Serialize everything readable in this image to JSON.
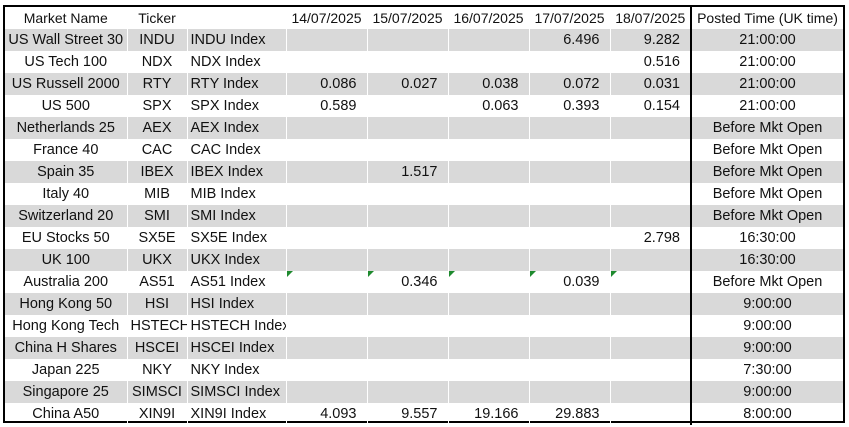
{
  "headers": [
    "Market Name",
    "Ticker",
    "",
    "14/07/2025",
    "15/07/2025",
    "16/07/2025",
    "17/07/2025",
    "18/07/2025",
    "Posted Time (UK time)"
  ],
  "rows": [
    {
      "market": "US Wall Street 30",
      "ticker": "INDU",
      "index": "INDU  Index",
      "vals": [
        "",
        "",
        "",
        "6.496",
        "9.282"
      ],
      "posted": "21:00:00",
      "flags": [
        false,
        false,
        false,
        false,
        false
      ]
    },
    {
      "market": "US Tech 100",
      "ticker": "NDX",
      "index": "NDX Index",
      "vals": [
        "",
        "",
        "",
        "",
        "0.516"
      ],
      "posted": "21:00:00",
      "flags": [
        false,
        false,
        false,
        false,
        false
      ]
    },
    {
      "market": "US Russell 2000",
      "ticker": "RTY",
      "index": "RTY Index",
      "vals": [
        "0.086",
        "0.027",
        "0.038",
        "0.072",
        "0.031"
      ],
      "posted": "21:00:00",
      "flags": [
        false,
        false,
        false,
        false,
        false
      ]
    },
    {
      "market": "US 500",
      "ticker": "SPX",
      "index": "SPX Index",
      "vals": [
        "0.589",
        "",
        "0.063",
        "0.393",
        "0.154"
      ],
      "posted": "21:00:00",
      "flags": [
        false,
        false,
        false,
        false,
        false
      ]
    },
    {
      "market": "Netherlands 25",
      "ticker": "AEX",
      "index": "AEX Index",
      "vals": [
        "",
        "",
        "",
        "",
        ""
      ],
      "posted": "Before Mkt Open",
      "flags": [
        false,
        false,
        false,
        false,
        false
      ]
    },
    {
      "market": "France 40",
      "ticker": "CAC",
      "index": "CAC Index",
      "vals": [
        "",
        "",
        "",
        "",
        ""
      ],
      "posted": "Before Mkt Open",
      "flags": [
        false,
        false,
        false,
        false,
        false
      ]
    },
    {
      "market": "Spain 35",
      "ticker": "IBEX",
      "index": "IBEX Index",
      "vals": [
        "",
        "1.517",
        "",
        "",
        ""
      ],
      "posted": "Before Mkt Open",
      "flags": [
        false,
        false,
        false,
        false,
        false
      ]
    },
    {
      "market": "Italy 40",
      "ticker": "MIB",
      "index": "MIB Index",
      "vals": [
        "",
        "",
        "",
        "",
        ""
      ],
      "posted": "Before Mkt Open",
      "flags": [
        false,
        false,
        false,
        false,
        false
      ]
    },
    {
      "market": "Switzerland 20",
      "ticker": "SMI",
      "index": "SMI Index",
      "vals": [
        "",
        "",
        "",
        "",
        ""
      ],
      "posted": "Before Mkt Open",
      "flags": [
        false,
        false,
        false,
        false,
        false
      ]
    },
    {
      "market": "EU Stocks 50",
      "ticker": "SX5E",
      "index": "SX5E Index",
      "vals": [
        "",
        "",
        "",
        "",
        "2.798"
      ],
      "posted": "16:30:00",
      "flags": [
        false,
        false,
        false,
        false,
        false
      ]
    },
    {
      "market": "UK 100",
      "ticker": "UKX",
      "index": "UKX Index",
      "vals": [
        "",
        "",
        "",
        "",
        ""
      ],
      "posted": "16:30:00",
      "flags": [
        false,
        false,
        false,
        false,
        false
      ]
    },
    {
      "market": "Australia 200",
      "ticker": "AS51",
      "index": "AS51 Index",
      "vals": [
        "",
        "0.346",
        "",
        "0.039",
        ""
      ],
      "posted": "Before Mkt Open",
      "flags": [
        true,
        true,
        true,
        true,
        true
      ]
    },
    {
      "market": "Hong Kong 50",
      "ticker": "HSI",
      "index": "HSI Index",
      "vals": [
        "",
        "",
        "",
        "",
        ""
      ],
      "posted": "9:00:00",
      "flags": [
        false,
        false,
        false,
        false,
        false
      ]
    },
    {
      "market": "Hong Kong Tech",
      "ticker": "HSTECH",
      "index": "HSTECH Index",
      "vals": [
        "",
        "",
        "",
        "",
        ""
      ],
      "posted": "9:00:00",
      "flags": [
        false,
        false,
        false,
        false,
        false
      ]
    },
    {
      "market": "China H Shares",
      "ticker": "HSCEI",
      "index": "HSCEI Index",
      "vals": [
        "",
        "",
        "",
        "",
        ""
      ],
      "posted": "9:00:00",
      "flags": [
        false,
        false,
        false,
        false,
        false
      ]
    },
    {
      "market": "Japan 225",
      "ticker": "NKY",
      "index": "NKY Index",
      "vals": [
        "",
        "",
        "",
        "",
        ""
      ],
      "posted": "7:30:00",
      "flags": [
        false,
        false,
        false,
        false,
        false
      ]
    },
    {
      "market": "Singapore 25",
      "ticker": "SIMSCI",
      "index": "SIMSCI Index",
      "vals": [
        "",
        "",
        "",
        "",
        ""
      ],
      "posted": "9:00:00",
      "flags": [
        false,
        false,
        false,
        false,
        false
      ]
    },
    {
      "market": "China A50",
      "ticker": "XIN9I",
      "index": "XIN9I Index",
      "vals": [
        "4.093",
        "9.557",
        "19.166",
        "29.883",
        ""
      ],
      "posted": "8:00:00",
      "flags": [
        false,
        false,
        false,
        false,
        false
      ]
    }
  ],
  "colors": {
    "band": "#d9d9d9",
    "flag": "#1e8a2e",
    "border": "#000000"
  }
}
